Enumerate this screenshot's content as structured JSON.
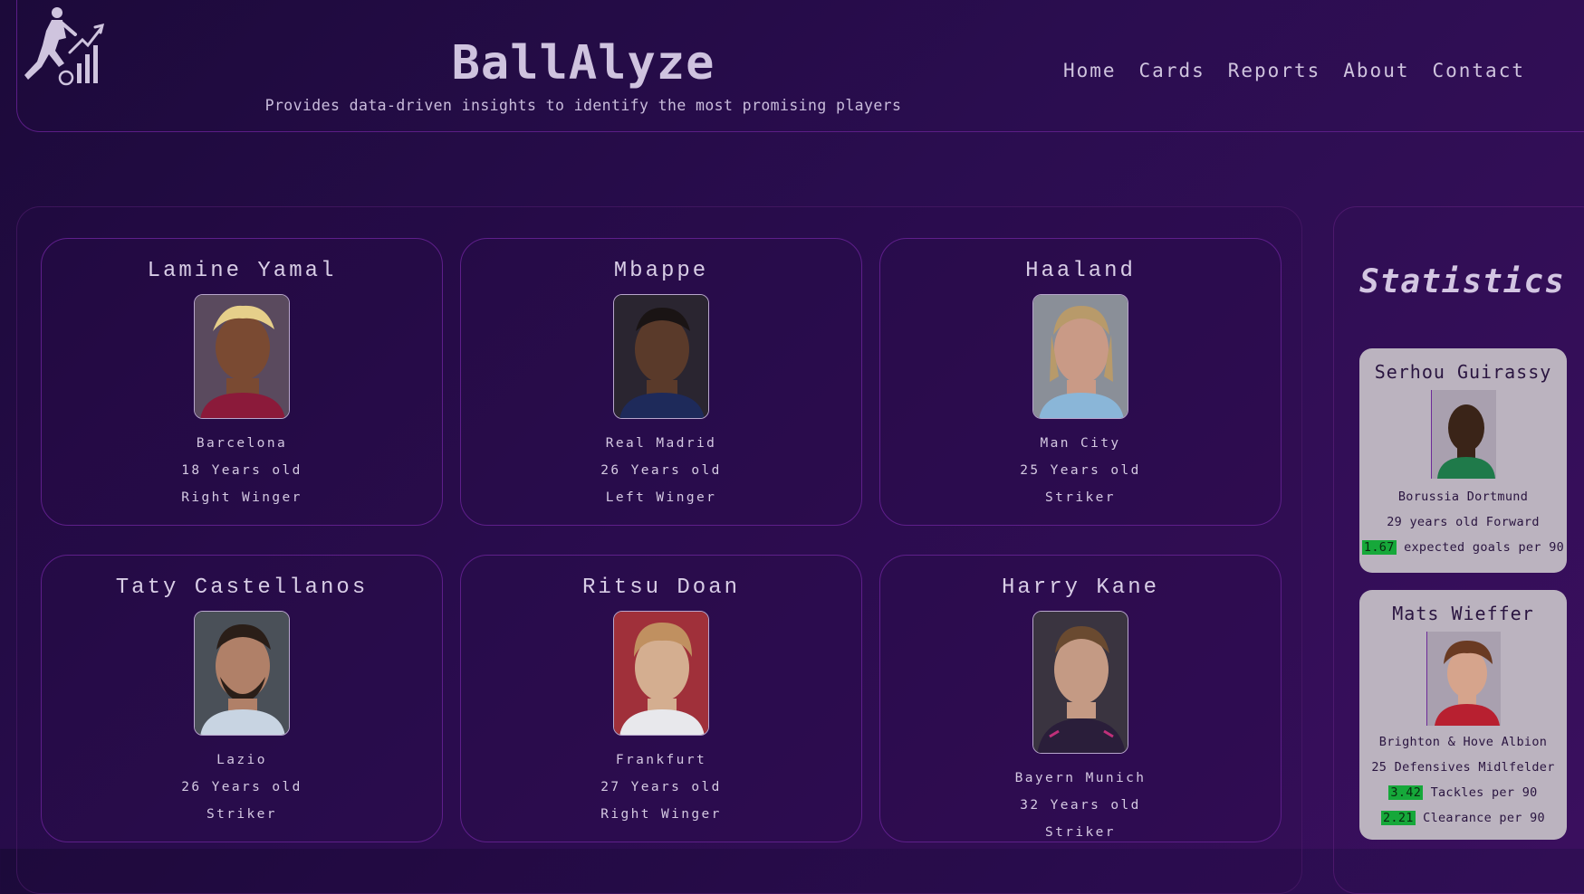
{
  "header": {
    "logo_icon": "soccer-player-chart-logo",
    "title": "BallAlyze",
    "subtitle": "Provides data-driven insights to identify the most promising players",
    "nav": [
      "Home",
      "Cards",
      "Reports",
      "About",
      "Contact"
    ]
  },
  "cards": [
    {
      "name": "Lamine Yamal",
      "club": "Barcelona",
      "age": "18 Years old",
      "position": "Right Winger"
    },
    {
      "name": "Mbappe",
      "club": "Real Madrid",
      "age": "26 Years old",
      "position": "Left Winger"
    },
    {
      "name": "Haaland",
      "club": "Man City",
      "age": "25 Years old",
      "position": "Striker"
    },
    {
      "name": "Taty Castellanos",
      "club": "Lazio",
      "age": "26 Years old",
      "position": "Striker"
    },
    {
      "name": "Ritsu Doan",
      "club": "Frankfurt",
      "age": "27 Years old",
      "position": "Right Winger"
    },
    {
      "name": "Harry Kane",
      "club": "Bayern Munich",
      "age": "32 Years old",
      "position": "Striker"
    }
  ],
  "statistics": {
    "title": "Statistics",
    "players": [
      {
        "name": "Serhou Guirassy",
        "club": "Borussia Dortmund",
        "info": "29 years old Forward",
        "stats": [
          {
            "value": "1.67",
            "label": " expected goals per 90"
          }
        ]
      },
      {
        "name": "Mats Wieffer",
        "club": "Brighton & Hove Albion",
        "info": "25 Defensives Midlfelder",
        "stats": [
          {
            "value": "3.42",
            "label": " Tackles per 90"
          },
          {
            "value": "2.21",
            "label": " Clearance per 90"
          }
        ]
      }
    ]
  },
  "colors": {
    "accent": "#5e1f8a",
    "highlight": "#16a83a",
    "stat_card_bg": "#bbb3bf"
  }
}
